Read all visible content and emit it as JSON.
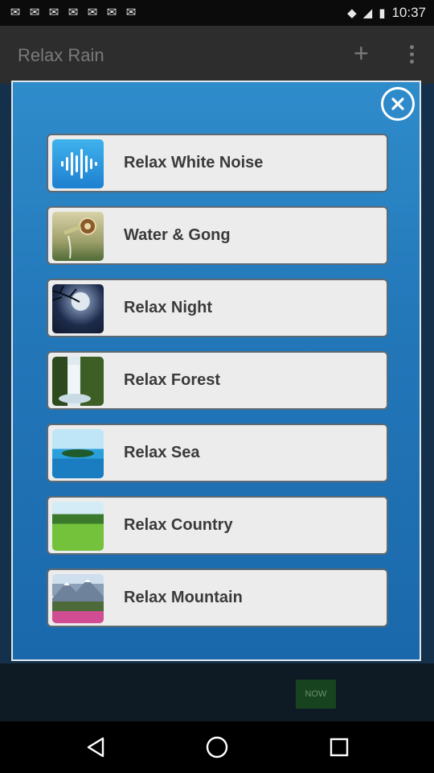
{
  "status_bar": {
    "left_icons": [
      "✉",
      "✉",
      "✉",
      "✉",
      "✉",
      "✉",
      "✉"
    ],
    "left_icon_names": [
      "notification-icon",
      "notification-icon",
      "notification-icon",
      "notification-icon",
      "notification-icon",
      "notification-icon",
      "notification-icon"
    ],
    "time": "10:37"
  },
  "app_bar": {
    "title": "Relax Rain",
    "add_glyph": "+"
  },
  "background": {
    "ad_text": "NOW"
  },
  "dialog": {
    "items": [
      {
        "label": "Relax White Noise"
      },
      {
        "label": "Water & Gong"
      },
      {
        "label": "Relax Night"
      },
      {
        "label": "Relax Forest"
      },
      {
        "label": "Relax Sea"
      },
      {
        "label": "Relax Country"
      },
      {
        "label": "Relax Mountain"
      }
    ]
  },
  "colors": {
    "dialog_top": "#2f8ccb",
    "dialog_bottom": "#1a68ac",
    "item_bg": "#ececec",
    "item_text": "#3a3a3a"
  }
}
